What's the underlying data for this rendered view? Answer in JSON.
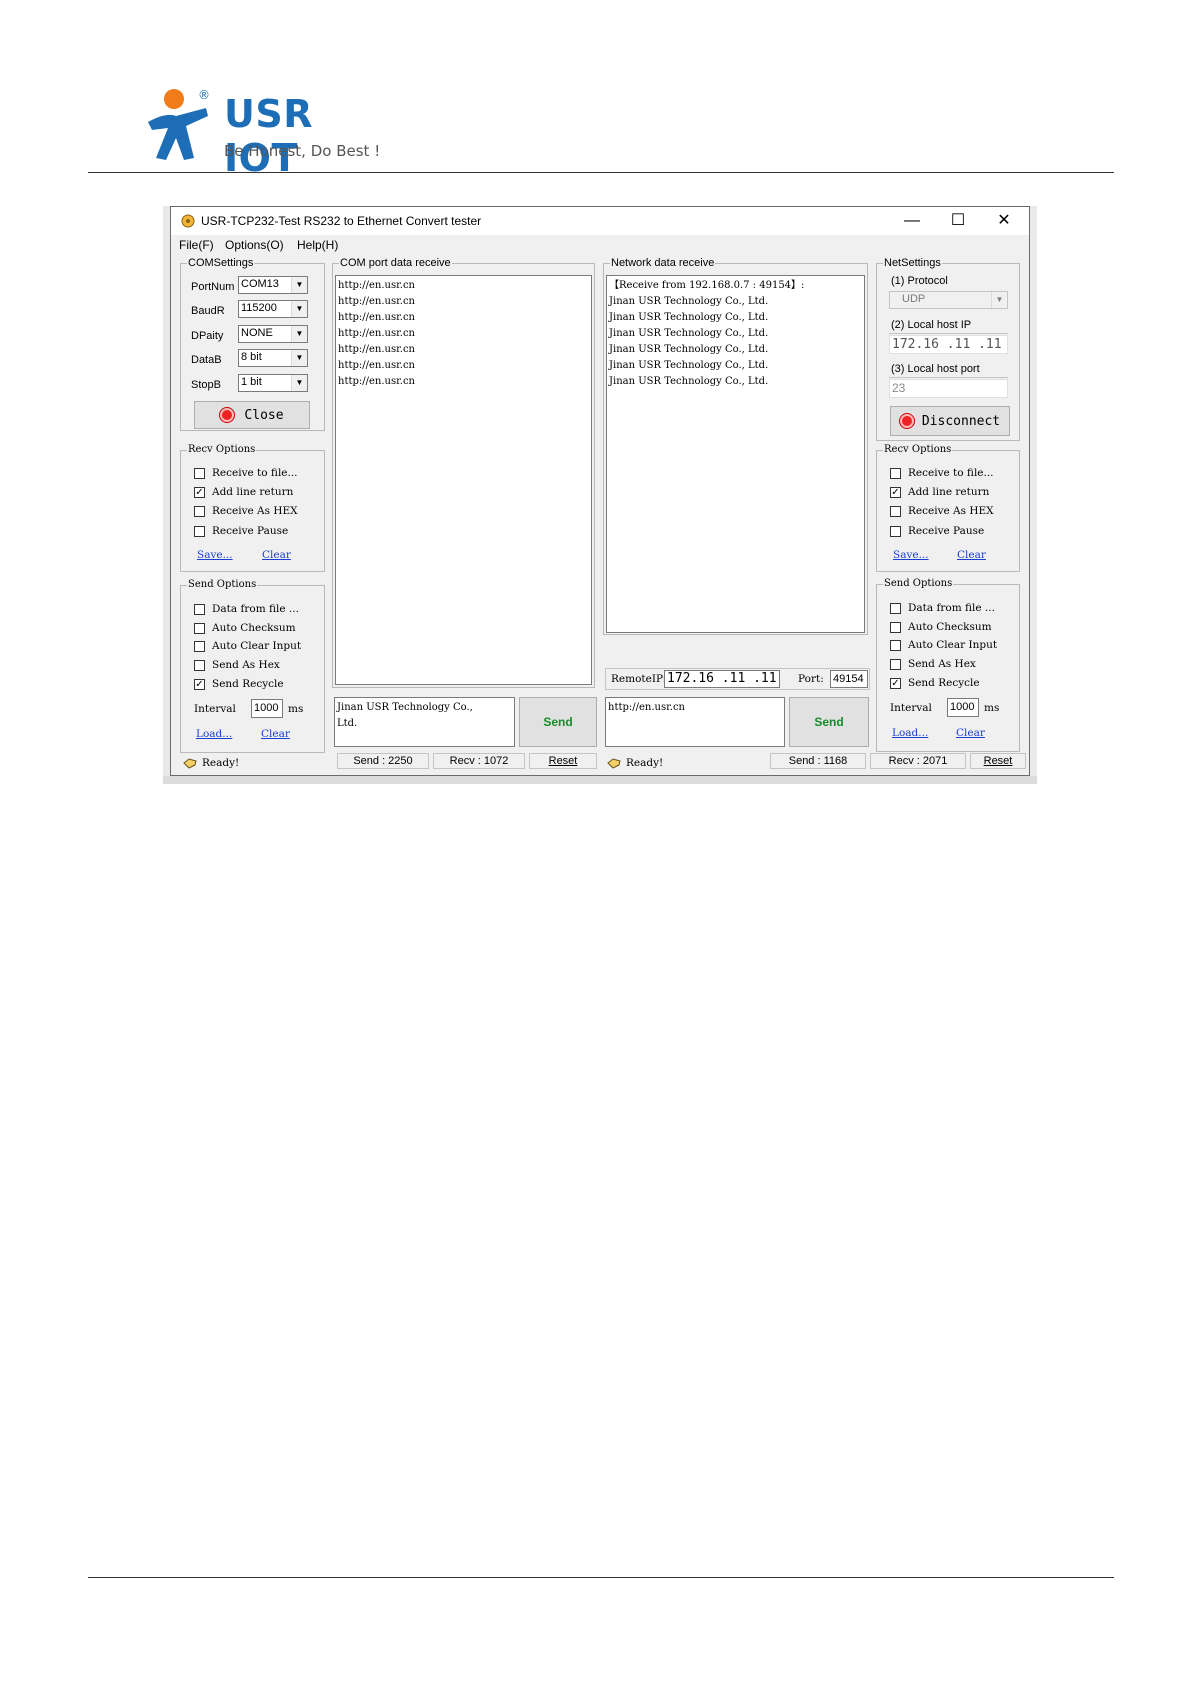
{
  "brand": {
    "name": "USR IOT",
    "registered": "®",
    "slogan": "Be Honest, Do Best !"
  },
  "window": {
    "title": "USR-TCP232-Test  RS232 to Ethernet Convert tester",
    "minimize": "—",
    "maximize": "☐",
    "close": "✕"
  },
  "menu": {
    "file": "File(F)",
    "options": "Options(O)",
    "help": "Help(H)"
  },
  "com_settings": {
    "title": "COMSettings",
    "fields": [
      {
        "label": "PortNum",
        "value": "COM13"
      },
      {
        "label": "BaudR",
        "value": "115200"
      },
      {
        "label": "DPaity",
        "value": "NONE"
      },
      {
        "label": "DataB",
        "value": "8 bit"
      },
      {
        "label": "StopB",
        "value": "1 bit"
      }
    ],
    "button": "Close"
  },
  "recv_options_left": {
    "title": "Recv Options",
    "options": [
      {
        "label": "Receive to file...",
        "checked": false
      },
      {
        "label": "Add line return",
        "checked": true
      },
      {
        "label": "Receive As HEX",
        "checked": false
      },
      {
        "label": "Receive Pause",
        "checked": false
      }
    ],
    "save": "Save...",
    "clear": "Clear"
  },
  "send_options_left": {
    "title": "Send Options",
    "options": [
      {
        "label": "Data from file ...",
        "checked": false
      },
      {
        "label": "Auto Checksum",
        "checked": false
      },
      {
        "label": "Auto Clear Input",
        "checked": false
      },
      {
        "label": "Send As Hex",
        "checked": false
      },
      {
        "label": "Send Recycle",
        "checked": true
      }
    ],
    "interval_label": "Interval",
    "interval_value": "1000",
    "interval_unit": "ms",
    "load": "Load...",
    "clear": "Clear"
  },
  "com_receive": {
    "title": "COM port data receive",
    "lines": [
      "http://en.usr.cn",
      "http://en.usr.cn",
      "http://en.usr.cn",
      "http://en.usr.cn",
      "http://en.usr.cn",
      "http://en.usr.cn",
      "http://en.usr.cn"
    ]
  },
  "com_send": {
    "text_line1": "Jinan USR Technology Co.,",
    "text_line2": "Ltd.",
    "send": "Send"
  },
  "net_receive": {
    "title": "Network data receive",
    "lines": [
      "【Receive from 192.168.0.7 : 49154】:",
      "Jinan USR Technology Co., Ltd.",
      "Jinan USR Technology Co., Ltd.",
      "Jinan USR Technology Co., Ltd.",
      "Jinan USR Technology Co., Ltd.",
      "Jinan USR Technology Co., Ltd.",
      "Jinan USR Technology Co., Ltd."
    ]
  },
  "net_remote": {
    "remote_label": "RemoteIP:",
    "remote_ip": "172.16 .11 .11",
    "port_label": "Port:",
    "port": "49154"
  },
  "net_send": {
    "text": "http://en.usr.cn",
    "send": "Send"
  },
  "net_settings": {
    "title": "NetSettings",
    "protocol_label": "(1) Protocol",
    "protocol_value": "UDP",
    "local_ip_label": "(2) Local host IP",
    "local_ip_value": "172.16 .11 .11",
    "local_port_label": "(3) Local host port",
    "local_port_value": "23",
    "button": "Disconnect"
  },
  "recv_options_right": {
    "title": "Recv Options",
    "options": [
      {
        "label": "Receive to file...",
        "checked": false
      },
      {
        "label": "Add line return",
        "checked": true
      },
      {
        "label": "Receive As HEX",
        "checked": false
      },
      {
        "label": "Receive Pause",
        "checked": false
      }
    ],
    "save": "Save...",
    "clear": "Clear"
  },
  "send_options_right": {
    "title": "Send Options",
    "options": [
      {
        "label": "Data from file ...",
        "checked": false
      },
      {
        "label": "Auto Checksum",
        "checked": false
      },
      {
        "label": "Auto Clear Input",
        "checked": false
      },
      {
        "label": "Send As Hex",
        "checked": false
      },
      {
        "label": "Send Recycle",
        "checked": true
      }
    ],
    "interval_label": "Interval",
    "interval_value": "1000",
    "interval_unit": "ms",
    "load": "Load...",
    "clear": "Clear"
  },
  "status_left": {
    "ready": "Ready!",
    "send": "Send : 2250",
    "recv": "Recv : 1072",
    "reset": "Reset"
  },
  "status_right": {
    "ready": "Ready!",
    "send": "Send : 1168",
    "recv": "Recv : 2071",
    "reset": "Reset"
  },
  "colors": {
    "brand_blue": "#1d6eb6",
    "logo_orange": "#f07c1a",
    "send_green": "#1a8a2a",
    "link_blue": "#1a3fd0",
    "indicator_red": "#e22222"
  }
}
